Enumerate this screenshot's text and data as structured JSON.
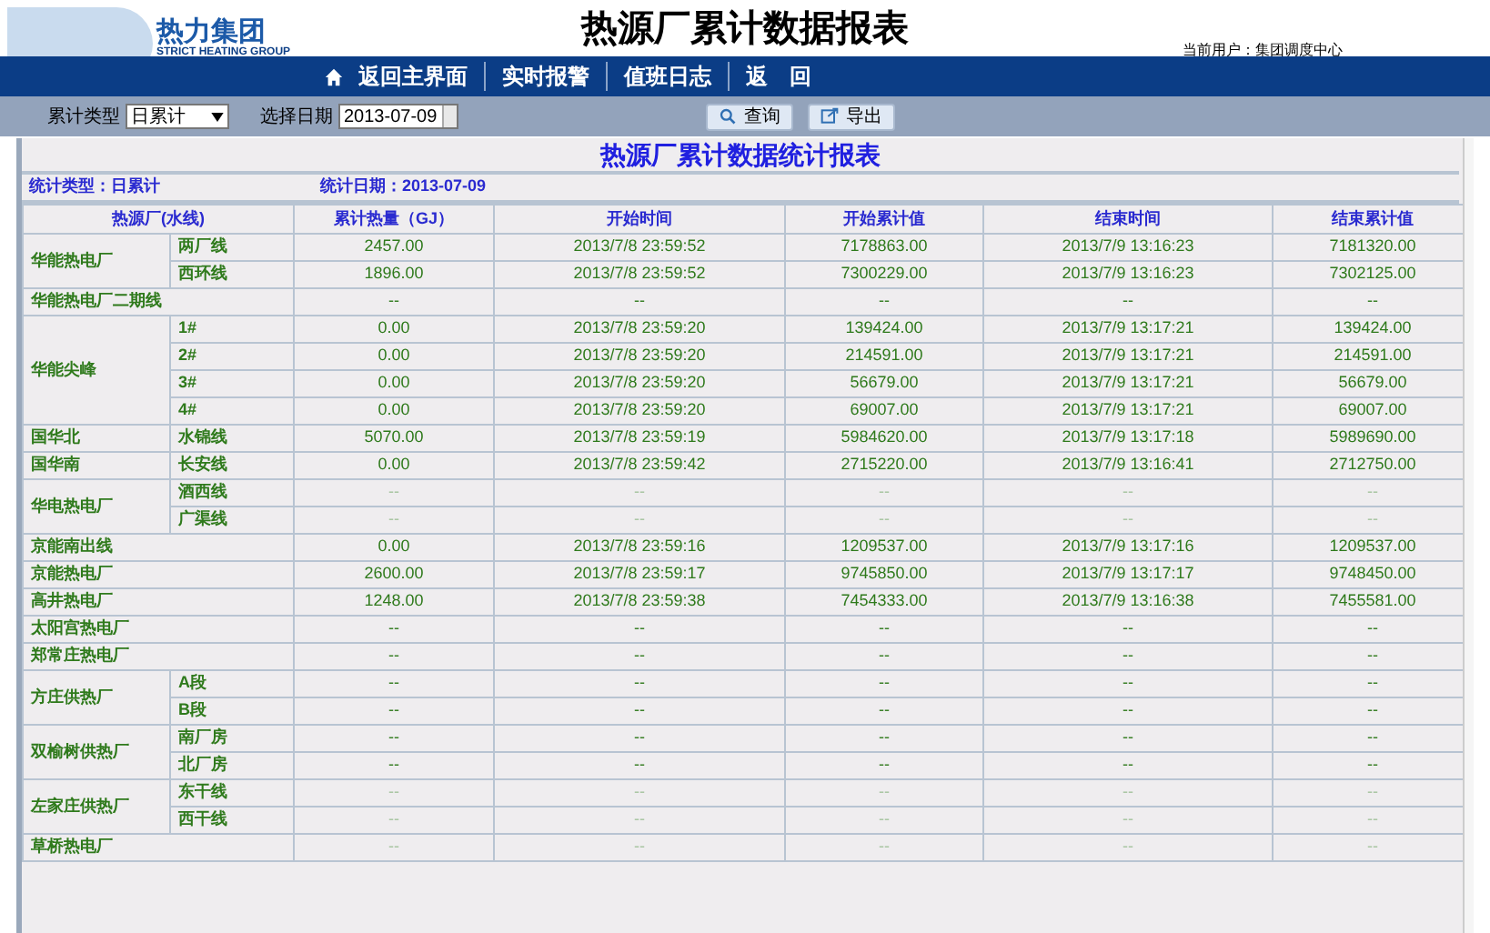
{
  "header": {
    "logo_text": "热力集团",
    "logo_subtitle": "STRICT HEATING GROUP",
    "title": "热源厂累计数据报表",
    "current_user": "当前用户：集团调度中心"
  },
  "nav": [
    "返回主界面",
    "实时报警",
    "值班日志",
    "返　回"
  ],
  "toolbar": {
    "type_label": "累计类型",
    "type_value": "日累计",
    "date_label": "选择日期",
    "date_value": "2013-07-09",
    "buttons": [
      {
        "kind": "search",
        "label": "查询"
      },
      {
        "kind": "export",
        "label": "导出"
      }
    ]
  },
  "report": {
    "title": "热源厂累计数据统计报表",
    "stat_type": "统计类型：日累计",
    "stat_date": "统计日期：2013-07-09",
    "columns": [
      "热源厂(水线)",
      "累计热量（GJ）",
      "开始时间",
      "开始累计值",
      "结束时间",
      "结束累计值"
    ],
    "groups": [
      {
        "kind": "split",
        "plant": "华能热电厂",
        "muted": false,
        "lines": [
          {
            "line": "两厂线",
            "values": [
              "2457.00",
              "2013/7/8 23:59:52",
              "7178863.00",
              "2013/7/9 13:16:23",
              "7181320.00"
            ]
          },
          {
            "line": "西环线",
            "values": [
              "1896.00",
              "2013/7/8 23:59:52",
              "7300229.00",
              "2013/7/9 13:16:23",
              "7302125.00"
            ]
          }
        ]
      },
      {
        "kind": "single",
        "plant": "华能热电厂二期线",
        "muted": false,
        "values": [
          "--",
          "--",
          "--",
          "--",
          "--"
        ]
      },
      {
        "kind": "split",
        "plant": "华能尖峰",
        "muted": false,
        "lines": [
          {
            "line": "1#",
            "values": [
              "0.00",
              "2013/7/8 23:59:20",
              "139424.00",
              "2013/7/9 13:17:21",
              "139424.00"
            ]
          },
          {
            "line": "2#",
            "values": [
              "0.00",
              "2013/7/8 23:59:20",
              "214591.00",
              "2013/7/9 13:17:21",
              "214591.00"
            ]
          },
          {
            "line": "3#",
            "values": [
              "0.00",
              "2013/7/8 23:59:20",
              "56679.00",
              "2013/7/9 13:17:21",
              "56679.00"
            ]
          },
          {
            "line": "4#",
            "values": [
              "0.00",
              "2013/7/8 23:59:20",
              "69007.00",
              "2013/7/9 13:17:21",
              "69007.00"
            ]
          }
        ]
      },
      {
        "kind": "split",
        "plant": "国华北",
        "muted": false,
        "lines": [
          {
            "line": "水锦线",
            "values": [
              "5070.00",
              "2013/7/8 23:59:19",
              "5984620.00",
              "2013/7/9 13:17:18",
              "5989690.00"
            ]
          }
        ]
      },
      {
        "kind": "split",
        "plant": "国华南",
        "muted": false,
        "lines": [
          {
            "line": "长安线",
            "values": [
              "0.00",
              "2013/7/8 23:59:42",
              "2715220.00",
              "2013/7/9 13:16:41",
              "2712750.00"
            ]
          }
        ]
      },
      {
        "kind": "split",
        "plant": "华电热电厂",
        "muted": true,
        "lines": [
          {
            "line": "酒西线",
            "values": [
              "--",
              "--",
              "--",
              "--",
              "--"
            ]
          },
          {
            "line": "广渠线",
            "values": [
              "--",
              "--",
              "--",
              "--",
              "--"
            ]
          }
        ]
      },
      {
        "kind": "single",
        "plant": "京能南出线",
        "muted": false,
        "values": [
          "0.00",
          "2013/7/8 23:59:16",
          "1209537.00",
          "2013/7/9 13:17:16",
          "1209537.00"
        ]
      },
      {
        "kind": "single",
        "plant": "京能热电厂",
        "muted": false,
        "values": [
          "2600.00",
          "2013/7/8 23:59:17",
          "9745850.00",
          "2013/7/9 13:17:17",
          "9748450.00"
        ]
      },
      {
        "kind": "single",
        "plant": "高井热电厂",
        "muted": false,
        "values": [
          "1248.00",
          "2013/7/8 23:59:38",
          "7454333.00",
          "2013/7/9 13:16:38",
          "7455581.00"
        ]
      },
      {
        "kind": "single",
        "plant": "太阳宫热电厂",
        "muted": false,
        "values": [
          "--",
          "--",
          "--",
          "--",
          "--"
        ]
      },
      {
        "kind": "single",
        "plant": "郑常庄热电厂",
        "muted": false,
        "values": [
          "--",
          "--",
          "--",
          "--",
          "--"
        ]
      },
      {
        "kind": "split",
        "plant": "方庄供热厂",
        "muted": false,
        "lines": [
          {
            "line": "A段",
            "values": [
              "--",
              "--",
              "--",
              "--",
              "--"
            ]
          },
          {
            "line": "B段",
            "values": [
              "--",
              "--",
              "--",
              "--",
              "--"
            ]
          }
        ]
      },
      {
        "kind": "split",
        "plant": "双榆树供热厂",
        "muted": false,
        "lines": [
          {
            "line": "南厂房",
            "values": [
              "--",
              "--",
              "--",
              "--",
              "--"
            ]
          },
          {
            "line": "北厂房",
            "values": [
              "--",
              "--",
              "--",
              "--",
              "--"
            ]
          }
        ]
      },
      {
        "kind": "split",
        "plant": "左家庄供热厂",
        "muted": true,
        "lines": [
          {
            "line": "东干线",
            "values": [
              "--",
              "--",
              "--",
              "--",
              "--"
            ]
          },
          {
            "line": "西干线",
            "values": [
              "--",
              "--",
              "--",
              "--",
              "--"
            ]
          }
        ]
      },
      {
        "kind": "single",
        "plant": "草桥热电厂",
        "muted": true,
        "values": [
          "--",
          "--",
          "--",
          "--",
          "--"
        ]
      }
    ]
  }
}
